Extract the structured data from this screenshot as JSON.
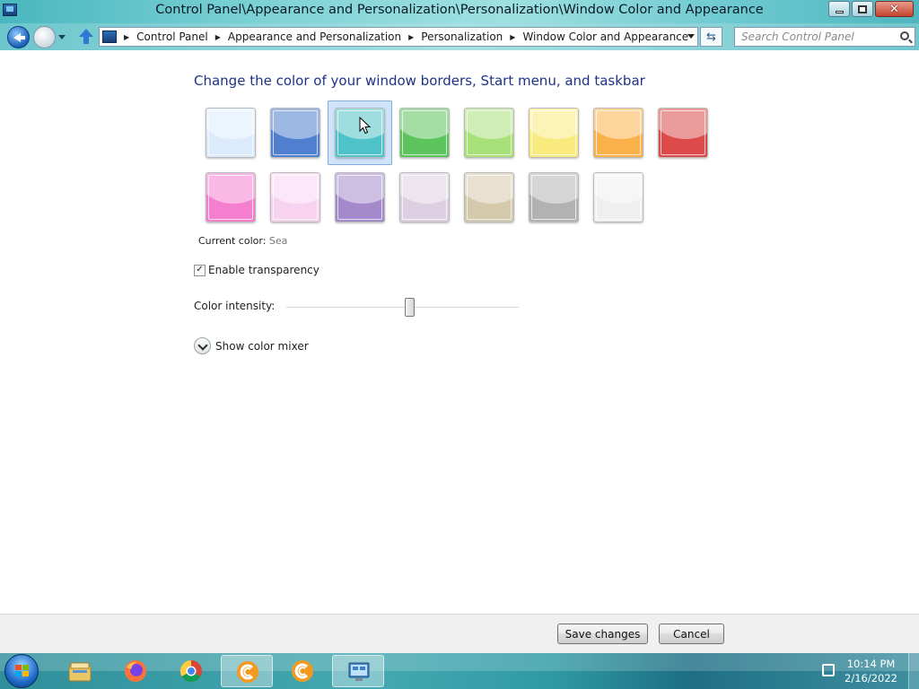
{
  "window": {
    "title": "Control Panel\\Appearance and Personalization\\Personalization\\Window Color and Appearance"
  },
  "nav": {
    "breadcrumbs": [
      "Control Panel",
      "Appearance and Personalization",
      "Personalization",
      "Window Color and Appearance"
    ],
    "search_placeholder": "Search Control Panel"
  },
  "main": {
    "heading": "Change the color of your window borders, Start menu, and taskbar",
    "swatches": [
      {
        "name": "sky",
        "color": "#dcebfb",
        "selected": false
      },
      {
        "name": "twilight",
        "color": "#4f7fce",
        "selected": false
      },
      {
        "name": "sea",
        "color": "#4fc3c9",
        "selected": true
      },
      {
        "name": "leaf",
        "color": "#5cc45c",
        "selected": false
      },
      {
        "name": "lime",
        "color": "#a8e07a",
        "selected": false
      },
      {
        "name": "sun",
        "color": "#f8ea7f",
        "selected": false
      },
      {
        "name": "pumpkin",
        "color": "#fbb14a",
        "selected": false
      },
      {
        "name": "ruby",
        "color": "#dc4a4a",
        "selected": false
      },
      {
        "name": "fuchsia",
        "color": "#f57fcf",
        "selected": false
      },
      {
        "name": "blush",
        "color": "#f7d3f0",
        "selected": false
      },
      {
        "name": "violet",
        "color": "#a58acb",
        "selected": false
      },
      {
        "name": "lavender",
        "color": "#ddcfe2",
        "selected": false
      },
      {
        "name": "taupe",
        "color": "#d5c9ac",
        "selected": false
      },
      {
        "name": "chocolate",
        "color": "#b2b2b2",
        "selected": false
      },
      {
        "name": "slate",
        "color": "#efefef",
        "selected": false
      }
    ],
    "current_color_label": "Current color:",
    "current_color_value": "Sea",
    "transparency_label": "Enable transparency",
    "transparency_checked": true,
    "intensity_label": "Color intensity:",
    "intensity_fraction": 0.53,
    "mixer_label": "Show color mixer"
  },
  "footer": {
    "save_label": "Save changes",
    "cancel_label": "Cancel"
  },
  "taskbar": {
    "clock_time": "10:14 PM",
    "clock_date": "2/16/2022",
    "items": [
      "file-explorer-icon",
      "firefox-icon",
      "chrome-icon",
      "ccleaner-icon",
      "ccleaner-icon",
      "control-panel-icon"
    ]
  }
}
